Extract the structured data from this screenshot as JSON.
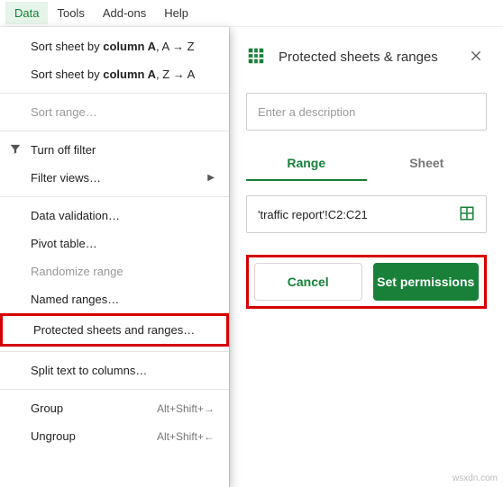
{
  "menubar": {
    "data": "Data",
    "tools": "Tools",
    "addons": "Add-ons",
    "help": "Help"
  },
  "dropdown": {
    "sort_az_prefix": "Sort sheet by ",
    "sort_col": "column A",
    "sort_az_suffix": ", A → Z",
    "sort_za_prefix": "Sort sheet by ",
    "sort_za_suffix": ", Z → A",
    "sort_range": "Sort range…",
    "turn_off_filter": "Turn off filter",
    "filter_views": "Filter views…",
    "data_validation": "Data validation…",
    "pivot_table": "Pivot table…",
    "randomize": "Randomize range",
    "named_ranges": "Named ranges…",
    "protected": "Protected sheets and ranges…",
    "split_text": "Split text to columns…",
    "group": "Group",
    "group_kbd": "Alt+Shift+→",
    "ungroup": "Ungroup",
    "ungroup_kbd": "Alt+Shift+←"
  },
  "panel": {
    "title": "Protected sheets & ranges",
    "desc_placeholder": "Enter a description",
    "tab_range": "Range",
    "tab_sheet": "Sheet",
    "range_value": "'traffic report'!C2:C21",
    "cancel": "Cancel",
    "set_permissions": "Set permissions"
  },
  "watermark": "wsxdn.com"
}
